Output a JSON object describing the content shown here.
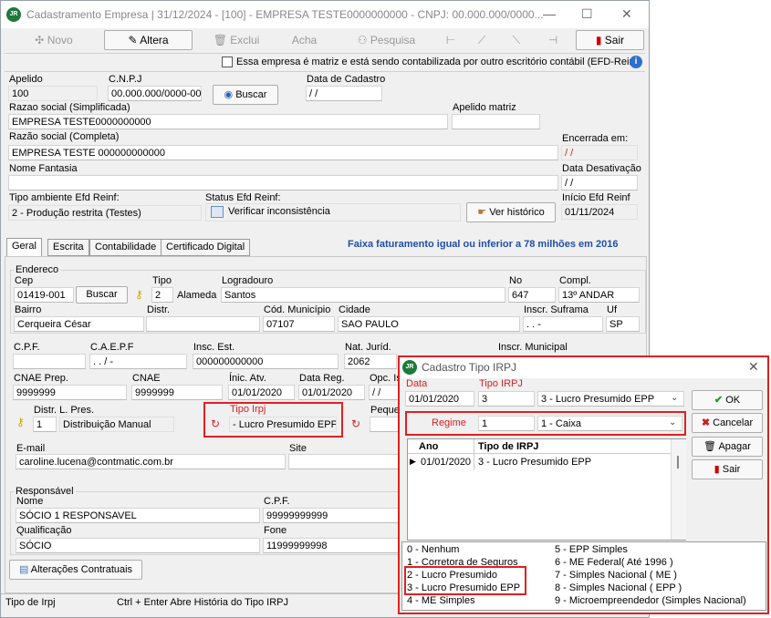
{
  "window": {
    "title": "Cadastramento Empresa | 31/12/2024 - [100] - EMPRESA TESTE0000000000 - CNPJ: 00.000.000/0000...",
    "logo": "JR"
  },
  "toolbar": {
    "novo": "Novo",
    "altera": "Altera",
    "exclui": "Exclui",
    "acha": "Acha",
    "pesquisa": "Pesquisa",
    "sair": "Sair"
  },
  "matriz_checkbox_label": "Essa empresa é matriz e está sendo contabilizada por outro escritório contábil (EFD-Reinf",
  "header": {
    "apelido_label": "Apelido",
    "apelido": "100",
    "cnpj_label": "C.N.P.J",
    "cnpj": "00.000.000/0000-00",
    "buscar": "Buscar",
    "data_cadastro_label": "Data de Cadastro",
    "data_cadastro": " / /",
    "razao_simpl_label": "Razao social (Simplificada)",
    "razao_simpl": "EMPRESA TESTE0000000000",
    "apelido_matriz_label": "Apelido matriz",
    "apelido_matriz": "",
    "razao_comp_label": "Razão social (Completa)",
    "razao_comp": "EMPRESA TESTE 000000000000",
    "encerrada_label": "Encerrada em:",
    "encerrada": " / /",
    "fantasia_label": "Nome Fantasia",
    "fantasia": "",
    "desativacao_label": "Data Desativação",
    "desativacao": " / /",
    "tipo_amb_label": "Tipo ambiente Efd Reinf:",
    "tipo_amb": "2 - Produção restrita (Testes)",
    "status_label": "Status Efd Reinf:",
    "verificar": "Verificar inconsistência",
    "historico": "Ver histórico",
    "inicio_label": "Início Efd Reinf",
    "inicio": "01/11/2024"
  },
  "tabs": [
    "Geral",
    "Escrita",
    "Contabilidade",
    "Certificado Digital"
  ],
  "faixa": "Faixa faturamento igual ou inferior a 78 milhões em 2016",
  "geral": {
    "endereco_label": "Endereco",
    "cep_label": "Cep",
    "cep": "01419-001",
    "buscar": "Buscar",
    "tipo_label": "Tipo",
    "tipo": "2",
    "tipo_desc": "Alameda",
    "logradouro_label": "Logradouro",
    "logradouro": "Santos",
    "no_label": "No",
    "no": "647",
    "compl_label": "Compl.",
    "compl": "13º ANDAR",
    "bairro_label": "Bairro",
    "bairro": "Cerqueira César",
    "distr_label": "Distr.",
    "distr": "",
    "cod_mun_label": "Cód. Município",
    "cod_mun": "07107",
    "cidade_label": "Cidade",
    "cidade": "SAO PAULO",
    "suframa_label": "Inscr. Suframa",
    "suframa": " .   .   -",
    "uf_label": "Uf",
    "uf": "SP",
    "cpf_label": "C.P.F.",
    "cpf": "",
    "caepf_label": "C.A.E.P.F",
    "caepf": " .   .   /   -",
    "insc_est_label": "Insc. Est.",
    "insc_est": "000000000000",
    "nat_jur_label": "Nat. Juríd.",
    "nat_jur": "2062",
    "insc_mun_label": "Inscr. Municipal",
    "cnae_prep_label": "CNAE Prep.",
    "cnae_prep": "9999999",
    "cnae_label": "CNAE",
    "cnae": "9999999",
    "inic_atv_label": "Ínic. Atv.",
    "inic_atv": "01/01/2020",
    "data_reg_label": "Data Reg.",
    "data_reg": "01/01/2020",
    "opc_label": "Opc. Is",
    "opc": " / /",
    "distr_pres_label": "Distr. L. Pres.",
    "distr_pres": "1",
    "distr_pres_desc": "Distribuição Manual",
    "tipo_irpj_label": "Tipo Irpj",
    "tipo_irpj": " - Lucro Presumido EPP",
    "peq_label": "Peque",
    "email_label": "E-mail",
    "email": "caroline.lucena@contmatic.com.br",
    "site_label": "Site",
    "site": "",
    "resp_label": "Responsável",
    "nome_label": "Nome",
    "nome": "SÓCIO 1 RESPONSAVEL",
    "resp_cpf_label": "C.P.F.",
    "resp_cpf": "99999999999",
    "qualif_label": "Qualificação",
    "qualif": "SÓCIO",
    "fone_label": "Fone",
    "fone": "11999999998",
    "alteracoes": "Alterações Contratuais"
  },
  "status_bar": {
    "left": "Tipo de Irpj",
    "hint": "Ctrl + Enter Abre História do Tipo IRPJ"
  },
  "dialog": {
    "title": "Cadastro Tipo IRPJ",
    "data_label": "Data",
    "data": "01/01/2020",
    "tipo_label": "Tipo IRPJ",
    "tipo": "3",
    "tipo_sel": "3 - Lucro Presumido EPP",
    "regime_label": "Regime",
    "regime": "1",
    "regime_sel": "1 - Caixa",
    "ok": "OK",
    "cancelar": "Cancelar",
    "apagar": "Apagar",
    "sair": "Sair",
    "grid_cols": [
      "Ano",
      "Tipo de IRPJ"
    ],
    "grid_rows": [
      [
        "01/01/2020",
        "3 - Lucro Presumido EPP"
      ]
    ],
    "legend_left": [
      "0 - Nenhum",
      "1 - Corretora de Seguros",
      "2 - Lucro Presumido",
      "3 - Lucro Presumido EPP",
      "4 - ME Simples"
    ],
    "legend_right": [
      "5 - EPP Simples",
      "6 - ME Federal( Até 1996 )",
      "7 - Simples Nacional ( ME )",
      "8 - Simples Nacional ( EPP )",
      "9 - Microempreendedor (Simples Nacional)"
    ]
  },
  "colors": {
    "accent_red": "#e02020",
    "faixa_blue": "#1f4fa8",
    "logo_green": "#1d7a3a"
  }
}
